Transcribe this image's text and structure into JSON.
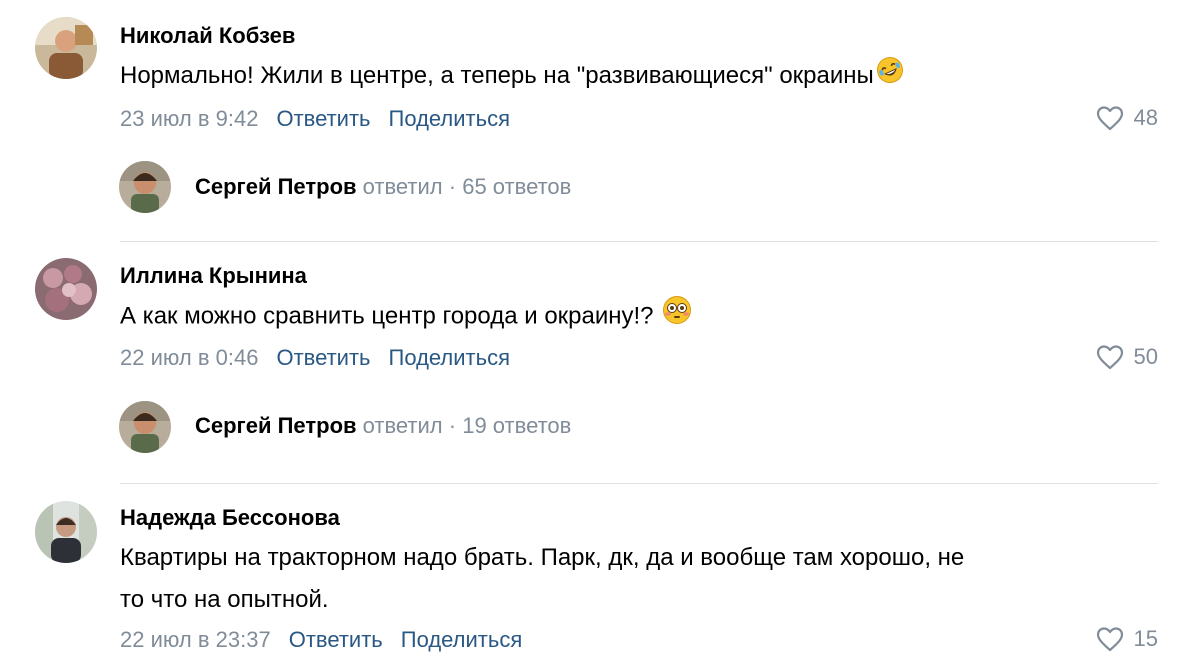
{
  "comments": [
    {
      "author": "Николай Кобзев",
      "text": "Нормально! Жили в центре, а теперь на \"развивающиеся\" окраины",
      "emoji": "rolling-on-floor-laughing-emoji",
      "date": "23 июл в 9:42",
      "reply_label": "Ответить",
      "share_label": "Поделиться",
      "likes": "48",
      "reply": {
        "name": "Сергей Петров",
        "verb": "ответил",
        "dot": "·",
        "count": "65 ответов"
      }
    },
    {
      "author": "Иллина Крынина",
      "text": "А как можно сравнить центр города и окраину!?",
      "emoji": "flushed-face-emoji",
      "date": "22 июл в 0:46",
      "reply_label": "Ответить",
      "share_label": "Поделиться",
      "likes": "50",
      "reply": {
        "name": "Сергей Петров",
        "verb": "ответил",
        "dot": "·",
        "count": "19 ответов"
      }
    },
    {
      "author": "Надежда Бессонова",
      "text_line1": "Квартиры на тракторном надо брать. Парк, дк, да и вообще там хорошо, не",
      "text_line2": "то что на опытной.",
      "date": "22 июл в 23:37",
      "reply_label": "Ответить",
      "share_label": "Поделиться",
      "likes": "15"
    }
  ],
  "colors": {
    "link": "#2a5885",
    "meta": "#818c99",
    "divider": "#dce1e6"
  },
  "icons": {
    "like": "heart-outline-icon"
  }
}
